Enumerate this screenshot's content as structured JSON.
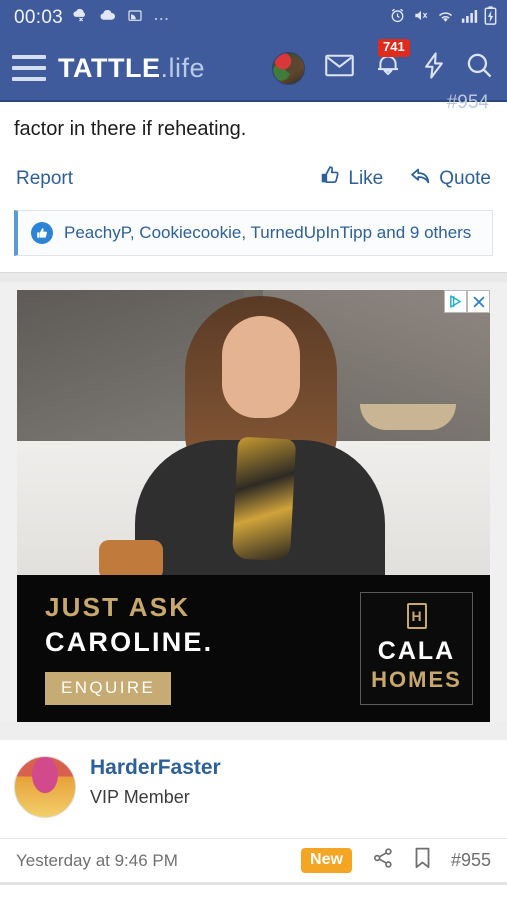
{
  "status_bar": {
    "clock": "00:03",
    "left_icons": [
      "weather-snow-icon",
      "cloud-icon",
      "cast-screen-icon",
      "more-dots-icon"
    ],
    "right_icons": [
      "alarm-icon",
      "vibrate-mute-icon",
      "wifi-icon",
      "cell-signal-icon",
      "battery-charging-icon"
    ]
  },
  "header": {
    "brand_primary": "TATTLE",
    "brand_secondary": ".life",
    "menu_icon": "hamburger-icon",
    "avatar_label": "user-avatar",
    "inbox_icon": "envelope-icon",
    "alerts_icon": "alerts-bell-icon",
    "alerts_count": "741",
    "bolt_icon": "lightning-bolt-icon",
    "search_icon": "search-icon",
    "background": "#3f5b9b"
  },
  "post_top": {
    "cut_post_number": "#954",
    "text": "factor in there if reheating.",
    "report_label": "Report",
    "like_label": "Like",
    "quote_label": "Quote",
    "link_color": "#2d6099"
  },
  "likes_bar": {
    "icon": "thumbs-up-circle-icon",
    "text": "PeachyP, Cookiecookie, TurnedUpInTipp and 9 others",
    "accent": "#5a9bd5"
  },
  "ad": {
    "adchoices_icon": "adchoices-icon",
    "close_icon": "close-icon",
    "headline_line1": "JUST ASK",
    "headline_line2": "CAROLINE.",
    "cta_label": "ENQUIRE",
    "brand_line1": "CALA",
    "brand_line2": "HOMES",
    "brand_monogram": "H",
    "gold": "#c8a86c",
    "background": "#080808"
  },
  "post_next": {
    "avatar_label": "harderfaster-avatar",
    "username": "HarderFaster",
    "user_title": "VIP Member",
    "timestamp": "Yesterday at 9:46 PM",
    "new_badge": "New",
    "share_icon": "share-icon",
    "bookmark_icon": "bookmark-icon",
    "post_number": "#955",
    "badge_color": "#f5a524"
  }
}
